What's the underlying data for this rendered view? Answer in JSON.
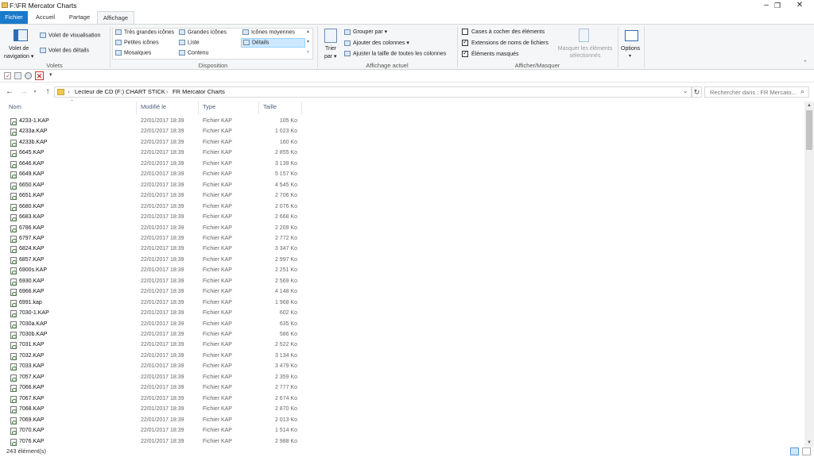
{
  "window": {
    "title": "F:\\FR Mercator Charts",
    "minimize": "–",
    "maximize": "❐",
    "close": "✕"
  },
  "tabs": [
    "Fichier",
    "Accueil",
    "Partage",
    "Affichage"
  ],
  "ribbon": {
    "volets": {
      "nav_pane_1": "Volet de",
      "nav_pane_2": "navigation ▾",
      "preview": "Volet de visualisation",
      "details": "Volet des détails",
      "label": "Volets"
    },
    "disposition": {
      "layouts": [
        "Très grandes icônes",
        "Grandes icônes",
        "Icônes moyennes",
        "Petites icônes",
        "Liste",
        "Détails",
        "Mosaïques",
        "Contenu"
      ],
      "label": "Disposition"
    },
    "affichage_actuel": {
      "sort_1": "Trier",
      "sort_2": "par ▾",
      "group_by": "Grouper par ▾",
      "add_columns": "Ajouter des colonnes ▾",
      "fit_columns": "Ajuster la taille de toutes les colonnes",
      "label": "Affichage actuel"
    },
    "afficher_masquer": {
      "checkboxes": "Cases à cocher des éléments",
      "extensions": "Extensions de noms de fichiers",
      "hidden": "Éléments masqués",
      "hide_selected_1": "Masquer les éléments",
      "hide_selected_2": "sélectionnés",
      "label": "Afficher/Masquer"
    },
    "options": "Options"
  },
  "qat": {
    "dropdown": "▾"
  },
  "nav": {
    "back": "←",
    "forward": "→",
    "up": "↑",
    "chevron": "›",
    "dropdown": "⌄",
    "refresh": "↻",
    "search_icon": "⌕",
    "path": [
      "Lecteur de CD (F:) CHART STICK",
      "FR Mercator Charts"
    ],
    "search_placeholder": "Rechercher dans : FR Mercato..."
  },
  "columns": {
    "name": "Nom",
    "modified": "Modifié le",
    "type": "Type",
    "size": "Taille"
  },
  "files": [
    {
      "name": "4233-1.KAP",
      "date": "22/01/2017 18:39",
      "type": "Fichier KAP",
      "size": "105 Ko"
    },
    {
      "name": "4233a.KAP",
      "date": "22/01/2017 18:39",
      "type": "Fichier KAP",
      "size": "1 023 Ko"
    },
    {
      "name": "4233b.KAP",
      "date": "22/01/2017 18:39",
      "type": "Fichier KAP",
      "size": "160 Ko"
    },
    {
      "name": "6645.KAP",
      "date": "22/01/2017 18:39",
      "type": "Fichier KAP",
      "size": "2 855 Ko"
    },
    {
      "name": "6646.KAP",
      "date": "22/01/2017 18:39",
      "type": "Fichier KAP",
      "size": "3 139 Ko"
    },
    {
      "name": "6649.KAP",
      "date": "22/01/2017 18:39",
      "type": "Fichier KAP",
      "size": "5 157 Ko"
    },
    {
      "name": "6650.KAP",
      "date": "22/01/2017 18:39",
      "type": "Fichier KAP",
      "size": "4 545 Ko"
    },
    {
      "name": "6651.KAP",
      "date": "22/01/2017 18:39",
      "type": "Fichier KAP",
      "size": "2 706 Ko"
    },
    {
      "name": "6680.KAP",
      "date": "22/01/2017 18:39",
      "type": "Fichier KAP",
      "size": "2 076 Ko"
    },
    {
      "name": "6683.KAP",
      "date": "22/01/2017 18:39",
      "type": "Fichier KAP",
      "size": "2 668 Ko"
    },
    {
      "name": "6786.KAP",
      "date": "22/01/2017 18:39",
      "type": "Fichier KAP",
      "size": "2 209 Ko"
    },
    {
      "name": "6797.KAP",
      "date": "22/01/2017 18:39",
      "type": "Fichier KAP",
      "size": "2 772 Ko"
    },
    {
      "name": "6824.KAP",
      "date": "22/01/2017 18:39",
      "type": "Fichier KAP",
      "size": "3 347 Ko"
    },
    {
      "name": "6857.KAP",
      "date": "22/01/2017 18:39",
      "type": "Fichier KAP",
      "size": "2 997 Ko"
    },
    {
      "name": "6900s.KAP",
      "date": "22/01/2017 18:39",
      "type": "Fichier KAP",
      "size": "2 251 Ko"
    },
    {
      "name": "6930.KAP",
      "date": "22/01/2017 18:39",
      "type": "Fichier KAP",
      "size": "2 569 Ko"
    },
    {
      "name": "6966.KAP",
      "date": "22/01/2017 18:39",
      "type": "Fichier KAP",
      "size": "4 148 Ko"
    },
    {
      "name": "6991.kap",
      "date": "22/01/2017 18:39",
      "type": "Fichier KAP",
      "size": "1 968 Ko"
    },
    {
      "name": "7030-1.KAP",
      "date": "22/01/2017 18:39",
      "type": "Fichier KAP",
      "size": "602 Ko"
    },
    {
      "name": "7030a.KAP",
      "date": "22/01/2017 18:39",
      "type": "Fichier KAP",
      "size": "635 Ko"
    },
    {
      "name": "7030b.KAP",
      "date": "22/01/2017 18:39",
      "type": "Fichier KAP",
      "size": "586 Ko"
    },
    {
      "name": "7031.KAP",
      "date": "22/01/2017 18:39",
      "type": "Fichier KAP",
      "size": "2 522 Ko"
    },
    {
      "name": "7032.KAP",
      "date": "22/01/2017 18:39",
      "type": "Fichier KAP",
      "size": "3 134 Ko"
    },
    {
      "name": "7033.KAP",
      "date": "22/01/2017 18:39",
      "type": "Fichier KAP",
      "size": "3 479 Ko"
    },
    {
      "name": "7057.KAP",
      "date": "22/01/2017 18:39",
      "type": "Fichier KAP",
      "size": "2 359 Ko"
    },
    {
      "name": "7066.KAP",
      "date": "22/01/2017 18:39",
      "type": "Fichier KAP",
      "size": "2 777 Ko"
    },
    {
      "name": "7067.KAP",
      "date": "22/01/2017 18:39",
      "type": "Fichier KAP",
      "size": "2 674 Ko"
    },
    {
      "name": "7068.KAP",
      "date": "22/01/2017 18:39",
      "type": "Fichier KAP",
      "size": "2 870 Ko"
    },
    {
      "name": "7069.KAP",
      "date": "22/01/2017 18:39",
      "type": "Fichier KAP",
      "size": "2 013 Ko"
    },
    {
      "name": "7070.KAP",
      "date": "22/01/2017 18:39",
      "type": "Fichier KAP",
      "size": "1 514 Ko"
    },
    {
      "name": "7076.KAP",
      "date": "22/01/2017 18:39",
      "type": "Fichier KAP",
      "size": "2 988 Ko"
    }
  ],
  "status": {
    "count": "243 élément(s)"
  },
  "colors": {
    "accent": "#1979ca",
    "selection": "#cce8ff",
    "header_text": "#4c607a"
  }
}
